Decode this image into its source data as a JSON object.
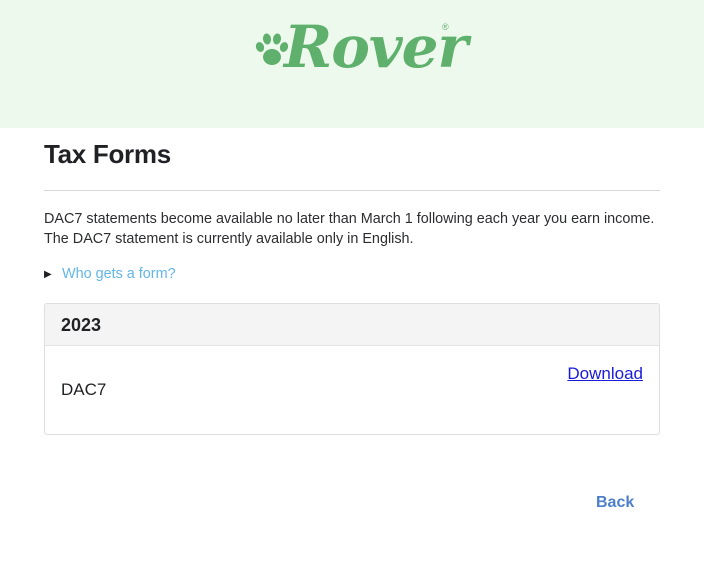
{
  "header": {
    "logo_text": "Rover",
    "logo_registered": "®"
  },
  "page": {
    "title": "Tax Forms",
    "description": "DAC7 statements become available no later than March 1 following each year you earn income. The DAC7 statement is currently available only in English.",
    "disclosure_arrow": "▶",
    "disclosure_label": "Who gets a form?"
  },
  "forms": [
    {
      "year": "2023",
      "name": "DAC7",
      "action_label": "Download"
    }
  ],
  "footer": {
    "back_label": "Back"
  },
  "colors": {
    "brand_green": "#5fb06d",
    "header_bg": "#eef9ed",
    "link_blue": "#1a1adb",
    "disclosure_blue": "#62b6e9",
    "back_blue": "#4d7fca"
  }
}
